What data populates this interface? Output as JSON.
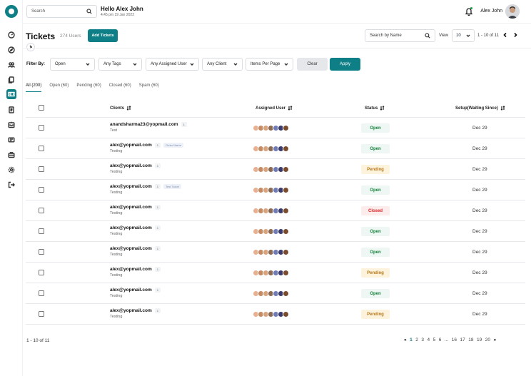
{
  "header": {
    "search_placeholder": "Search",
    "greeting": "Hello Alex John",
    "subtitle": "4:45 pm 19 Jan 2022",
    "user_name": "Alex John"
  },
  "page": {
    "title": "Tickets",
    "count": "274 Users",
    "add_label": "Add Tickets",
    "search_placeholder": "Search by Name",
    "view_label": "View",
    "view_value": "10",
    "range": "1 - 10 of 11"
  },
  "filters": {
    "label": "Filter By:",
    "status": "Open",
    "tags": "Any Tags",
    "assigned": "Any Assigned User",
    "client": "Any Client",
    "per_page": "Items Per Page",
    "clear_label": "Clear",
    "apply_label": "Apply"
  },
  "tabs": [
    "All (200)",
    "Open (60)",
    "Pending (60)",
    "Closed (60)",
    "Spam (60)"
  ],
  "table": {
    "headers": {
      "clients": "Clients",
      "assigned": "Assigned User",
      "status": "Status",
      "setup": "Setup(Waiting Since)"
    },
    "rows": [
      {
        "email": "anandsharma23@yopmail.com",
        "count": "1",
        "tag": "",
        "sub": "Test",
        "status": "Open",
        "date": "Dec 29"
      },
      {
        "email": "alex@yopmail.com",
        "count": "1",
        "tag": "Order Name",
        "sub": "Testing",
        "status": "Open",
        "date": "Dec 29"
      },
      {
        "email": "alex@yopmail.com",
        "count": "1",
        "tag": "",
        "sub": "Testing",
        "status": "Pending",
        "date": "Dec 29"
      },
      {
        "email": "alex@yopmail.com",
        "count": "1",
        "tag": "Test Ticket",
        "sub": "Testing",
        "status": "Open",
        "date": "Dec 29"
      },
      {
        "email": "alex@yopmail.com",
        "count": "1",
        "tag": "",
        "sub": "Testing",
        "status": "Closed",
        "date": "Dec 29"
      },
      {
        "email": "alex@yopmail.com",
        "count": "1",
        "tag": "",
        "sub": "Testing",
        "status": "Open",
        "date": "Dec 29"
      },
      {
        "email": "alex@yopmail.com",
        "count": "1",
        "tag": "",
        "sub": "Testing",
        "status": "Open",
        "date": "Dec 29"
      },
      {
        "email": "alex@yopmail.com",
        "count": "1",
        "tag": "",
        "sub": "Testing",
        "status": "Pending",
        "date": "Dec 29"
      },
      {
        "email": "alex@yopmail.com",
        "count": "1",
        "tag": "",
        "sub": "Testing",
        "status": "Open",
        "date": "Dec 29"
      },
      {
        "email": "alex@yopmail.com",
        "count": "1",
        "tag": "",
        "sub": "Testing",
        "status": "Pending",
        "date": "Dec 29"
      }
    ],
    "avatar_colors": [
      "#e8b08f",
      "#c48a63",
      "#d9a27a",
      "#8a6a52",
      "#6f7bb7",
      "#3b3b6b",
      "#7a4b2e"
    ]
  },
  "footer": {
    "range": "1 - 10 of 11",
    "first": "«",
    "last": "»",
    "pages": [
      "1",
      "2",
      "3",
      "4",
      "5",
      "6",
      "...",
      "16",
      "17",
      "18",
      "19",
      "20"
    ]
  },
  "colors": {
    "accent": "#0e7f86",
    "open": "#15803d",
    "pending": "#b7791f",
    "closed": "#dc2626"
  },
  "icons": {
    "sidebar": [
      "dashboard-icon",
      "compass-icon",
      "users-icon",
      "documents-icon",
      "ticket-icon",
      "report-icon",
      "inbox-icon",
      "mail-icon",
      "briefcase-icon",
      "settings-icon",
      "logout-icon"
    ]
  }
}
